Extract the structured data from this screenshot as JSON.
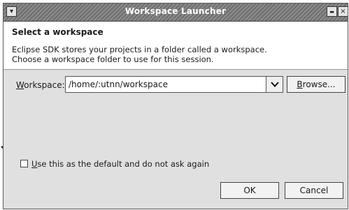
{
  "window": {
    "title": "Workspace Launcher",
    "menu_glyph": "▾",
    "minimize_glyph": "▬",
    "close_glyph": "×"
  },
  "header": {
    "title": "Select a workspace",
    "description_line1": "Eclipse SDK stores your projects in a folder called a workspace.",
    "description_line2": "Choose a workspace folder to use for this session."
  },
  "workspace": {
    "label_mnemonic": "W",
    "label_rest": "orkspace:",
    "value": "/home/:utnn/workspace",
    "browse_mnemonic": "B",
    "browse_rest": "rowse..."
  },
  "default_option": {
    "checked": false,
    "label_mnemonic": "U",
    "label_rest": "se this as the default and do not ask again"
  },
  "buttons": {
    "ok": "OK",
    "cancel": "Cancel"
  }
}
